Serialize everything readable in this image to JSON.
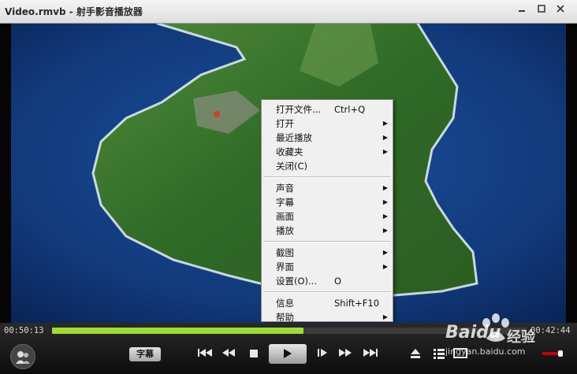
{
  "window": {
    "title": "Video.rmvb - 射手影音播放器",
    "minimize_icon": "minimize-icon",
    "maximize_icon": "maximize-icon",
    "close_icon": "close-icon"
  },
  "context_menu": {
    "groups": [
      [
        {
          "label": "打开文件...",
          "shortcut": "Ctrl+Q",
          "submenu": false
        },
        {
          "label": "打开",
          "shortcut": "",
          "submenu": true
        },
        {
          "label": "最近播放",
          "shortcut": "",
          "submenu": true
        },
        {
          "label": "收藏夹",
          "shortcut": "",
          "submenu": true
        },
        {
          "label": "关闭(C)",
          "shortcut": "",
          "submenu": false
        }
      ],
      [
        {
          "label": "声音",
          "shortcut": "",
          "submenu": true
        },
        {
          "label": "字幕",
          "shortcut": "",
          "submenu": true
        },
        {
          "label": "画面",
          "shortcut": "",
          "submenu": true
        },
        {
          "label": "播放",
          "shortcut": "",
          "submenu": true
        }
      ],
      [
        {
          "label": "截图",
          "shortcut": "",
          "submenu": true
        },
        {
          "label": "界面",
          "shortcut": "",
          "submenu": true
        },
        {
          "label": "设置(O)...",
          "shortcut": "O",
          "submenu": false
        }
      ],
      [
        {
          "label": "信息",
          "shortcut": "Shift+F10",
          "submenu": false
        },
        {
          "label": "帮助",
          "shortcut": "",
          "submenu": true
        }
      ]
    ]
  },
  "controls": {
    "elapsed": "00:50:13",
    "remaining": "00:42:44",
    "progress_fraction": 0.53,
    "subtitle_label": "字幕",
    "volume_fraction": 0.9
  },
  "watermark": {
    "brand": "Baidu",
    "suffix": "经验",
    "url": "jingyan.baidu.com"
  },
  "colors": {
    "progress": "#9fdc34",
    "volume": "#cc0000"
  }
}
